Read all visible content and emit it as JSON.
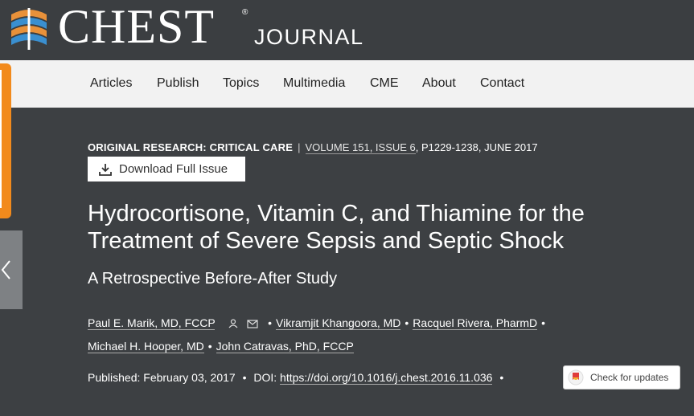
{
  "header": {
    "logo_text": "CHEST",
    "logo_reg": "®",
    "logo_sub": "JOURNAL"
  },
  "nav": {
    "items": [
      "Articles",
      "Publish",
      "Topics",
      "Multimedia",
      "CME",
      "About",
      "Contact"
    ]
  },
  "article": {
    "section": "ORIGINAL RESEARCH: CRITICAL CARE",
    "volume": "VOLUME 151, ISSUE 6",
    "pages_date": ", P1229-1238, JUNE 2017",
    "download_label": "Download Full Issue",
    "title": "Hydrocortisone, Vitamin C, and Thiamine for the Treatment of Severe Sepsis and Septic Shock",
    "subtitle": "A Retrospective Before-After Study",
    "authors": [
      "Paul E. Marik, MD, FCCP",
      "Vikramjit Khangoora, MD",
      "Racquel Rivera, PharmD",
      "Michael H. Hooper, MD",
      "John Catravas, PhD, FCCP"
    ],
    "published_label": "Published: February 03, 2017",
    "doi_label": "DOI:",
    "doi": "https://doi.org/10.1016/j.chest.2016.11.036",
    "check_updates": "Check for updates"
  },
  "colors": {
    "background": "#3d4043",
    "nav_bg": "#f2f2f2",
    "accent_orange": "#f28a1c",
    "logo_blue": "#3a8fd0",
    "logo_orange": "#e8913a"
  },
  "icons": [
    "logo-mark",
    "download-icon",
    "person-icon",
    "mail-icon",
    "chevron-left-icon",
    "crossmark-icon"
  ]
}
